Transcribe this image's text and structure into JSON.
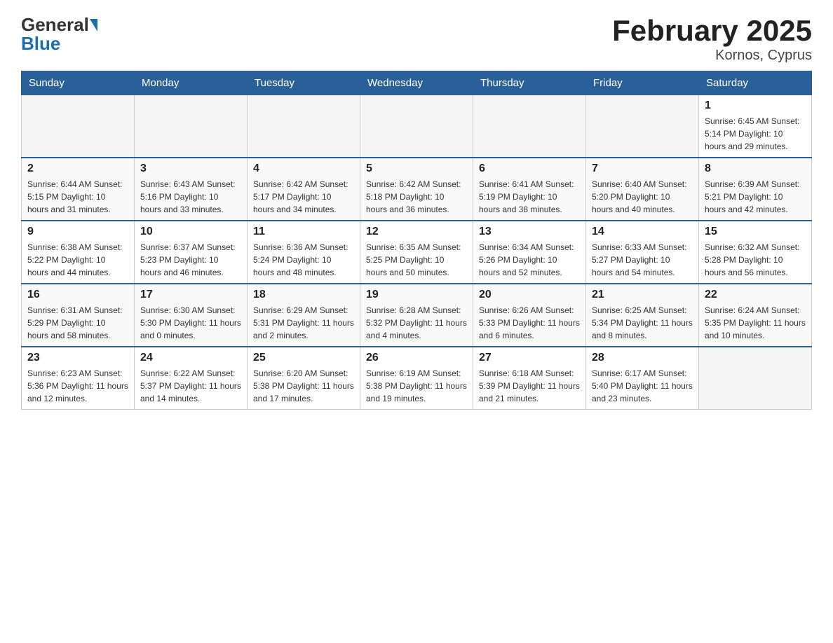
{
  "header": {
    "logo_general": "General",
    "logo_blue": "Blue",
    "title": "February 2025",
    "subtitle": "Kornos, Cyprus"
  },
  "days_of_week": [
    "Sunday",
    "Monday",
    "Tuesday",
    "Wednesday",
    "Thursday",
    "Friday",
    "Saturday"
  ],
  "weeks": [
    [
      {
        "day": "",
        "info": ""
      },
      {
        "day": "",
        "info": ""
      },
      {
        "day": "",
        "info": ""
      },
      {
        "day": "",
        "info": ""
      },
      {
        "day": "",
        "info": ""
      },
      {
        "day": "",
        "info": ""
      },
      {
        "day": "1",
        "info": "Sunrise: 6:45 AM\nSunset: 5:14 PM\nDaylight: 10 hours and 29 minutes."
      }
    ],
    [
      {
        "day": "2",
        "info": "Sunrise: 6:44 AM\nSunset: 5:15 PM\nDaylight: 10 hours and 31 minutes."
      },
      {
        "day": "3",
        "info": "Sunrise: 6:43 AM\nSunset: 5:16 PM\nDaylight: 10 hours and 33 minutes."
      },
      {
        "day": "4",
        "info": "Sunrise: 6:42 AM\nSunset: 5:17 PM\nDaylight: 10 hours and 34 minutes."
      },
      {
        "day": "5",
        "info": "Sunrise: 6:42 AM\nSunset: 5:18 PM\nDaylight: 10 hours and 36 minutes."
      },
      {
        "day": "6",
        "info": "Sunrise: 6:41 AM\nSunset: 5:19 PM\nDaylight: 10 hours and 38 minutes."
      },
      {
        "day": "7",
        "info": "Sunrise: 6:40 AM\nSunset: 5:20 PM\nDaylight: 10 hours and 40 minutes."
      },
      {
        "day": "8",
        "info": "Sunrise: 6:39 AM\nSunset: 5:21 PM\nDaylight: 10 hours and 42 minutes."
      }
    ],
    [
      {
        "day": "9",
        "info": "Sunrise: 6:38 AM\nSunset: 5:22 PM\nDaylight: 10 hours and 44 minutes."
      },
      {
        "day": "10",
        "info": "Sunrise: 6:37 AM\nSunset: 5:23 PM\nDaylight: 10 hours and 46 minutes."
      },
      {
        "day": "11",
        "info": "Sunrise: 6:36 AM\nSunset: 5:24 PM\nDaylight: 10 hours and 48 minutes."
      },
      {
        "day": "12",
        "info": "Sunrise: 6:35 AM\nSunset: 5:25 PM\nDaylight: 10 hours and 50 minutes."
      },
      {
        "day": "13",
        "info": "Sunrise: 6:34 AM\nSunset: 5:26 PM\nDaylight: 10 hours and 52 minutes."
      },
      {
        "day": "14",
        "info": "Sunrise: 6:33 AM\nSunset: 5:27 PM\nDaylight: 10 hours and 54 minutes."
      },
      {
        "day": "15",
        "info": "Sunrise: 6:32 AM\nSunset: 5:28 PM\nDaylight: 10 hours and 56 minutes."
      }
    ],
    [
      {
        "day": "16",
        "info": "Sunrise: 6:31 AM\nSunset: 5:29 PM\nDaylight: 10 hours and 58 minutes."
      },
      {
        "day": "17",
        "info": "Sunrise: 6:30 AM\nSunset: 5:30 PM\nDaylight: 11 hours and 0 minutes."
      },
      {
        "day": "18",
        "info": "Sunrise: 6:29 AM\nSunset: 5:31 PM\nDaylight: 11 hours and 2 minutes."
      },
      {
        "day": "19",
        "info": "Sunrise: 6:28 AM\nSunset: 5:32 PM\nDaylight: 11 hours and 4 minutes."
      },
      {
        "day": "20",
        "info": "Sunrise: 6:26 AM\nSunset: 5:33 PM\nDaylight: 11 hours and 6 minutes."
      },
      {
        "day": "21",
        "info": "Sunrise: 6:25 AM\nSunset: 5:34 PM\nDaylight: 11 hours and 8 minutes."
      },
      {
        "day": "22",
        "info": "Sunrise: 6:24 AM\nSunset: 5:35 PM\nDaylight: 11 hours and 10 minutes."
      }
    ],
    [
      {
        "day": "23",
        "info": "Sunrise: 6:23 AM\nSunset: 5:36 PM\nDaylight: 11 hours and 12 minutes."
      },
      {
        "day": "24",
        "info": "Sunrise: 6:22 AM\nSunset: 5:37 PM\nDaylight: 11 hours and 14 minutes."
      },
      {
        "day": "25",
        "info": "Sunrise: 6:20 AM\nSunset: 5:38 PM\nDaylight: 11 hours and 17 minutes."
      },
      {
        "day": "26",
        "info": "Sunrise: 6:19 AM\nSunset: 5:38 PM\nDaylight: 11 hours and 19 minutes."
      },
      {
        "day": "27",
        "info": "Sunrise: 6:18 AM\nSunset: 5:39 PM\nDaylight: 11 hours and 21 minutes."
      },
      {
        "day": "28",
        "info": "Sunrise: 6:17 AM\nSunset: 5:40 PM\nDaylight: 11 hours and 23 minutes."
      },
      {
        "day": "",
        "info": ""
      }
    ]
  ]
}
